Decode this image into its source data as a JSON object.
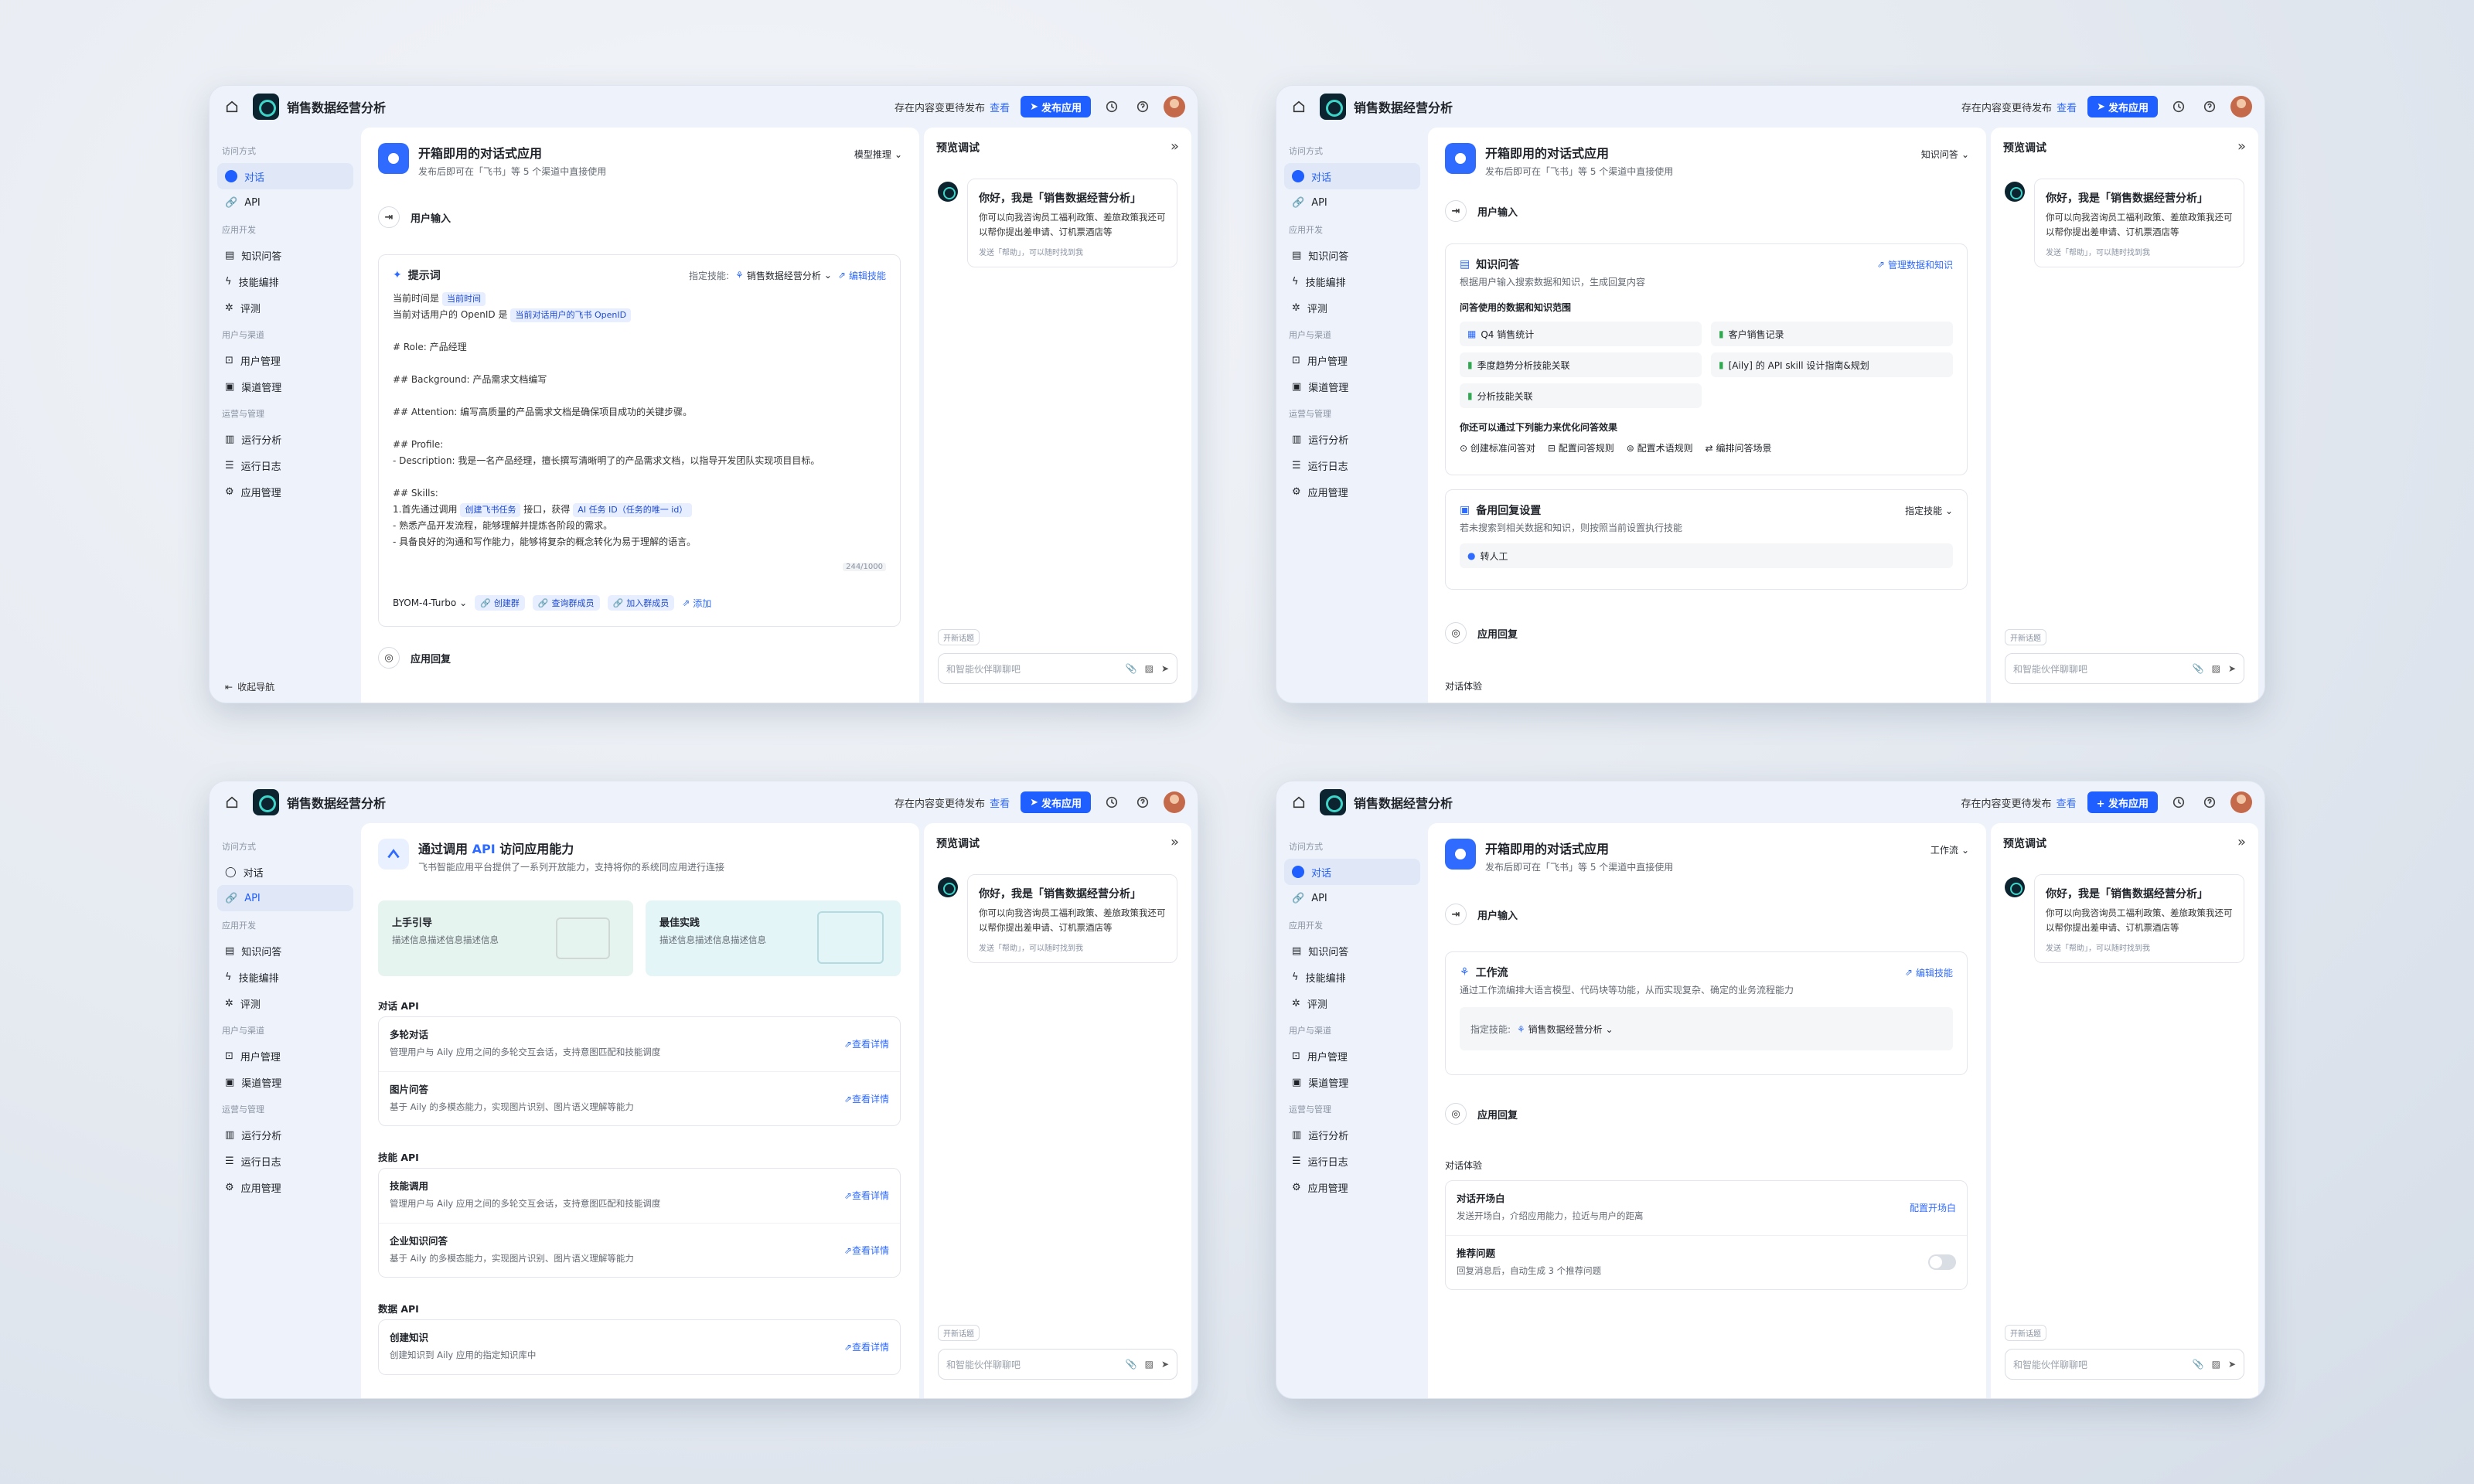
{
  "app": {
    "title": "销售数据经营分析",
    "pending": "存在内容变更待发布",
    "view": "查看",
    "publish": "发布应用",
    "publish_plus": "+ 发布应用"
  },
  "sidebar": {
    "sec_access": "访问方式",
    "sec_dev": "应用开发",
    "sec_user": "用户与渠道",
    "sec_ops": "运营与管理",
    "chat": "对话",
    "api": "API",
    "kb": "知识问答",
    "skill": "技能编排",
    "eval": "评测",
    "users": "用户管理",
    "channels": "渠道管理",
    "analytics": "运行分析",
    "logs": "运行日志",
    "manage": "应用管理",
    "collapse": "收起导航"
  },
  "header": {
    "title": "开箱即用的对话式应用",
    "sub": "发布后即可在「飞书」等 5 个渠道中直接使用",
    "mode1": "模型推理",
    "mode2": "知识问答",
    "mode4": "工作流"
  },
  "flow": {
    "input": "用户输入",
    "reply": "应用回复",
    "exp": "对话体验"
  },
  "prompt": {
    "title": "提示词",
    "skill_label": "指定技能:",
    "skill_val": "销售数据经营分析",
    "edit": "编辑技能",
    "l1": "当前时间是",
    "t1": "当前时间",
    "l2": "当前对话用户的 OpenID 是",
    "t2": "当前对话用户的飞书 OpenID",
    "role": "# Role: 产品经理",
    "bg": "## Background: 产品需求文档编写",
    "att": "## Attention: 编写高质量的产品需求文档是确保项目成功的关键步骤。",
    "prof": "## Profile:",
    "desc": "- Description: 我是一名产品经理，擅长撰写清晰明了的产品需求文档，以指导开发团队实现项目目标。",
    "skills": "## Skills:",
    "s1": "1.首先通过调用",
    "s1t": "创建飞书任务",
    "s1b": "接口，获得",
    "s1t2": "AI 任务 ID（任务的唯一 id）",
    "s2": "- 熟悉产品开发流程，能够理解并提炼各阶段的需求。",
    "s3": "- 具备良好的沟通和写作能力，能够将复杂的概念转化为易于理解的语言。",
    "count": "244/1000",
    "model": "BYOM-4-Turbo",
    "c1": "创建群",
    "c2": "查询群成员",
    "c3": "加入群成员",
    "add": "添加"
  },
  "preview": {
    "title": "预览调试",
    "greet": "你好，我是「销售数据经营分析」",
    "body": "你可以向我咨询员工福利政策、差旅政策我还可以帮你提出差申请、订机票酒店等",
    "hint": "发送「帮助」，可以随时找到我",
    "newchat": "开新话题",
    "placeholder": "和智能伙伴聊聊吧"
  },
  "kbq": {
    "title": "知识问答",
    "sub": "根据用户输入搜索数据和知识，生成回复内容",
    "manage": "管理数据和知识",
    "scope": "问答使用的数据和知识范围",
    "k1": "Q4 销售统计",
    "k2": "客户销售记录",
    "k3": "季度趋势分析技能关联",
    "k4": "[Aily] 的 API skill 设计指南&规划",
    "k5": "分析技能关联",
    "opt_title": "你还可以通过下列能力来优化问答效果",
    "o1": "创建标准问答对",
    "o2": "配置问答规则",
    "o3": "配置术语规则",
    "o4": "编排问答场景",
    "fb_title": "备用回复设置",
    "fb_sub": "若未搜索到相关数据和知识，则按照当前设置执行技能",
    "fb_mode": "指定技能",
    "fb_item": "转人工"
  },
  "api": {
    "title_a": "通过调用",
    "title_b": "API",
    "title_c": "访问应用能力",
    "sub": "飞书智能应用平台提供了一系列开放能力，支持将你的系统同应用进行连接",
    "guide": "上手引导",
    "guide_d": "描述信息描述信息描述信息",
    "best": "最佳实践",
    "best_d": "描述信息描述信息描述信息",
    "g1": "对话 API",
    "r1t": "多轮对话",
    "r1d": "管理用户与 Aily 应用之间的多轮交互会话，支持意图匹配和技能调度",
    "r2t": "图片问答",
    "r2d": "基于 Aily 的多模态能力，实现图片识别、图片语义理解等能力",
    "g2": "技能 API",
    "r3t": "技能调用",
    "r3d": "管理用户与 Aily 应用之间的多轮交互会话，支持意图匹配和技能调度",
    "r4t": "企业知识问答",
    "r4d": "基于 Aily 的多模态能力，实现图片识别、图片语义理解等能力",
    "g3": "数据 API",
    "r5t": "创建知识",
    "r5d": "创建知识到 Aily 应用的指定知识库中",
    "detail": "查看详情"
  },
  "wf": {
    "title": "工作流",
    "sub": "通过工作流编排大语言模型、代码块等功能，从而实现复杂、确定的业务流程能力",
    "edit": "编辑技能",
    "skill_label": "指定技能:",
    "skill_val": "销售数据经营分析",
    "open_t": "对话开场白",
    "open_d": "发送开场白，介绍应用能力，拉近与用户的距离",
    "open_cfg": "配置开场白",
    "rec_t": "推荐问题",
    "rec_d": "回复消息后，自动生成 3 个推荐问题"
  }
}
